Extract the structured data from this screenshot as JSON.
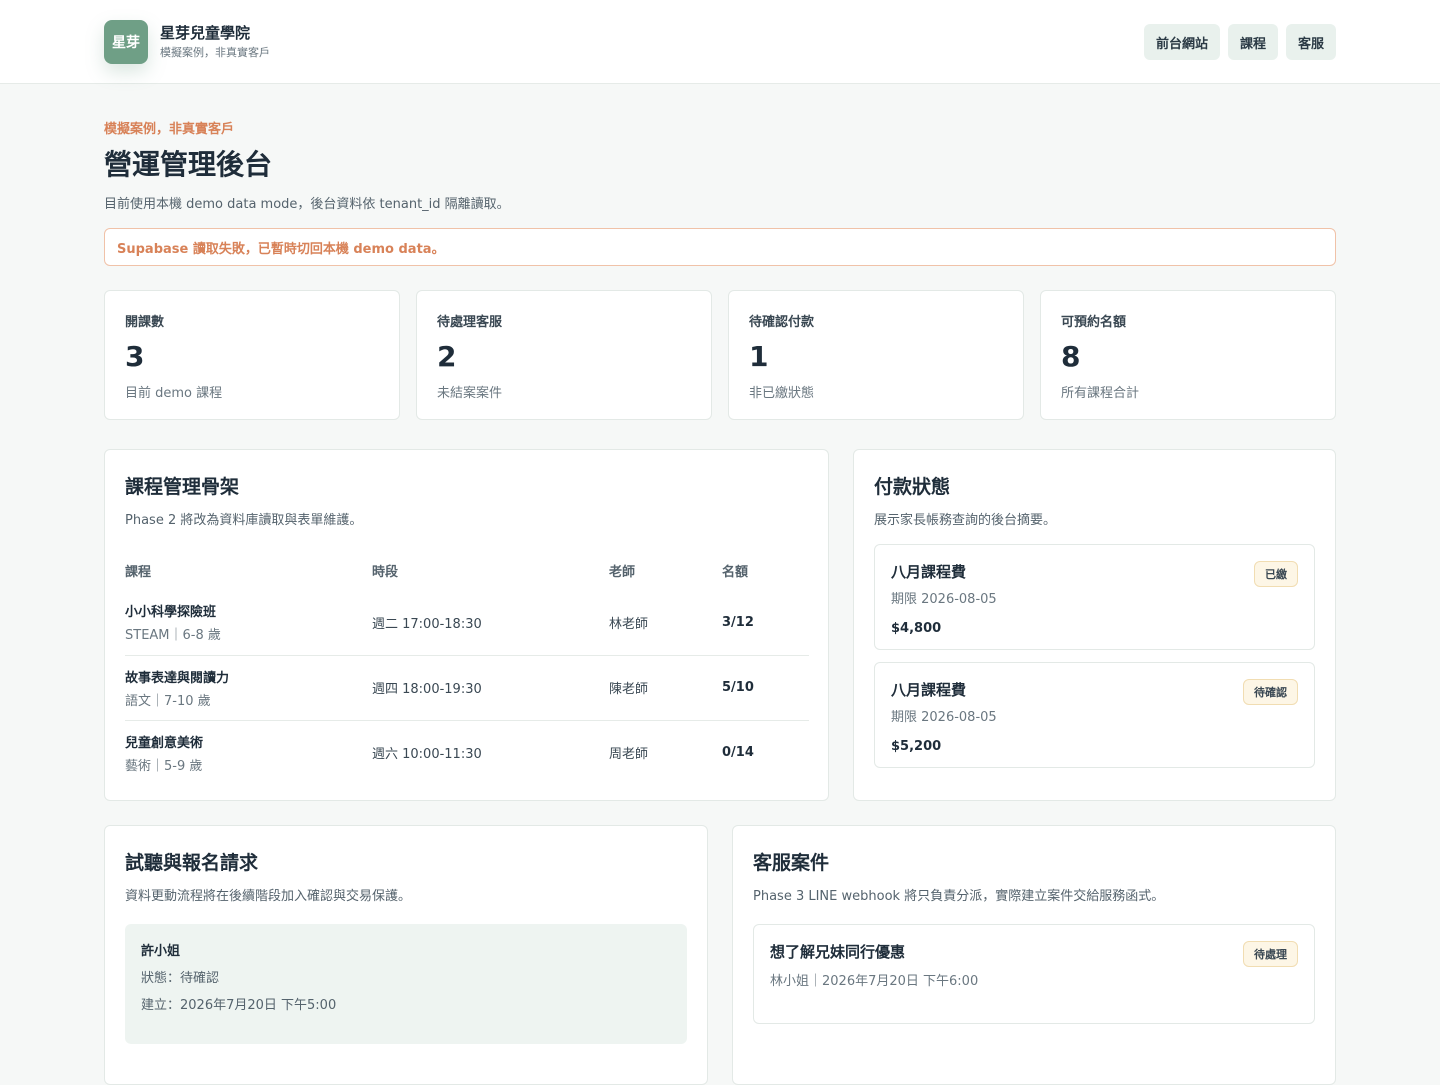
{
  "brand": {
    "logo_text": "星芽",
    "name": "星芽兒童學院",
    "subtitle": "模擬案例，非真實客戶"
  },
  "nav": {
    "items": [
      "前台網站",
      "課程",
      "客服"
    ]
  },
  "page": {
    "eyebrow": "模擬案例，非真實客戶",
    "title": "營運管理後台",
    "description": "目前使用本機 demo data mode，後台資料依 tenant_id 隔離讀取。",
    "alert": "Supabase 讀取失敗，已暫時切回本機 demo data。"
  },
  "stats": [
    {
      "label": "開課數",
      "value": "3",
      "note": "目前 demo 課程"
    },
    {
      "label": "待處理客服",
      "value": "2",
      "note": "未結案案件"
    },
    {
      "label": "待確認付款",
      "value": "1",
      "note": "非已繳狀態"
    },
    {
      "label": "可預約名額",
      "value": "8",
      "note": "所有課程合計"
    }
  ],
  "courses": {
    "title": "課程管理骨架",
    "subtitle": "Phase 2 將改為資料庫讀取與表單維護。",
    "headers": [
      "課程",
      "時段",
      "老師",
      "名額"
    ],
    "rows": [
      {
        "name": "小小科學探險班",
        "meta": "STEAM｜6-8 歲",
        "time": "週二 17:00-18:30",
        "teacher": "林老師",
        "seats": "3/12"
      },
      {
        "name": "故事表達與閱讀力",
        "meta": "語文｜7-10 歲",
        "time": "週四 18:00-19:30",
        "teacher": "陳老師",
        "seats": "5/10"
      },
      {
        "name": "兒童創意美術",
        "meta": "藝術｜5-9 歲",
        "time": "週六 10:00-11:30",
        "teacher": "周老師",
        "seats": "0/14"
      }
    ]
  },
  "payments": {
    "title": "付款狀態",
    "subtitle": "展示家長帳務查詢的後台摘要。",
    "items": [
      {
        "title": "八月課程費",
        "due": "期限 2026-08-05",
        "amount": "$4,800",
        "status": "已繳"
      },
      {
        "title": "八月課程費",
        "due": "期限 2026-08-05",
        "amount": "$5,200",
        "status": "待確認"
      }
    ]
  },
  "trials": {
    "title": "試聽與報名請求",
    "subtitle": "資料更動流程將在後續階段加入確認與交易保護。",
    "items": [
      {
        "name": "許小姐",
        "status": "狀態：待確認",
        "created": "建立：2026年7月20日 下午5:00"
      }
    ]
  },
  "cases": {
    "title": "客服案件",
    "subtitle": "Phase 3 LINE webhook 將只負責分派，實際建立案件交給服務函式。",
    "items": [
      {
        "title": "想了解兄妹同行優惠",
        "meta": "林小姐｜2026年7月20日 下午6:00",
        "status": "待處理"
      }
    ]
  }
}
